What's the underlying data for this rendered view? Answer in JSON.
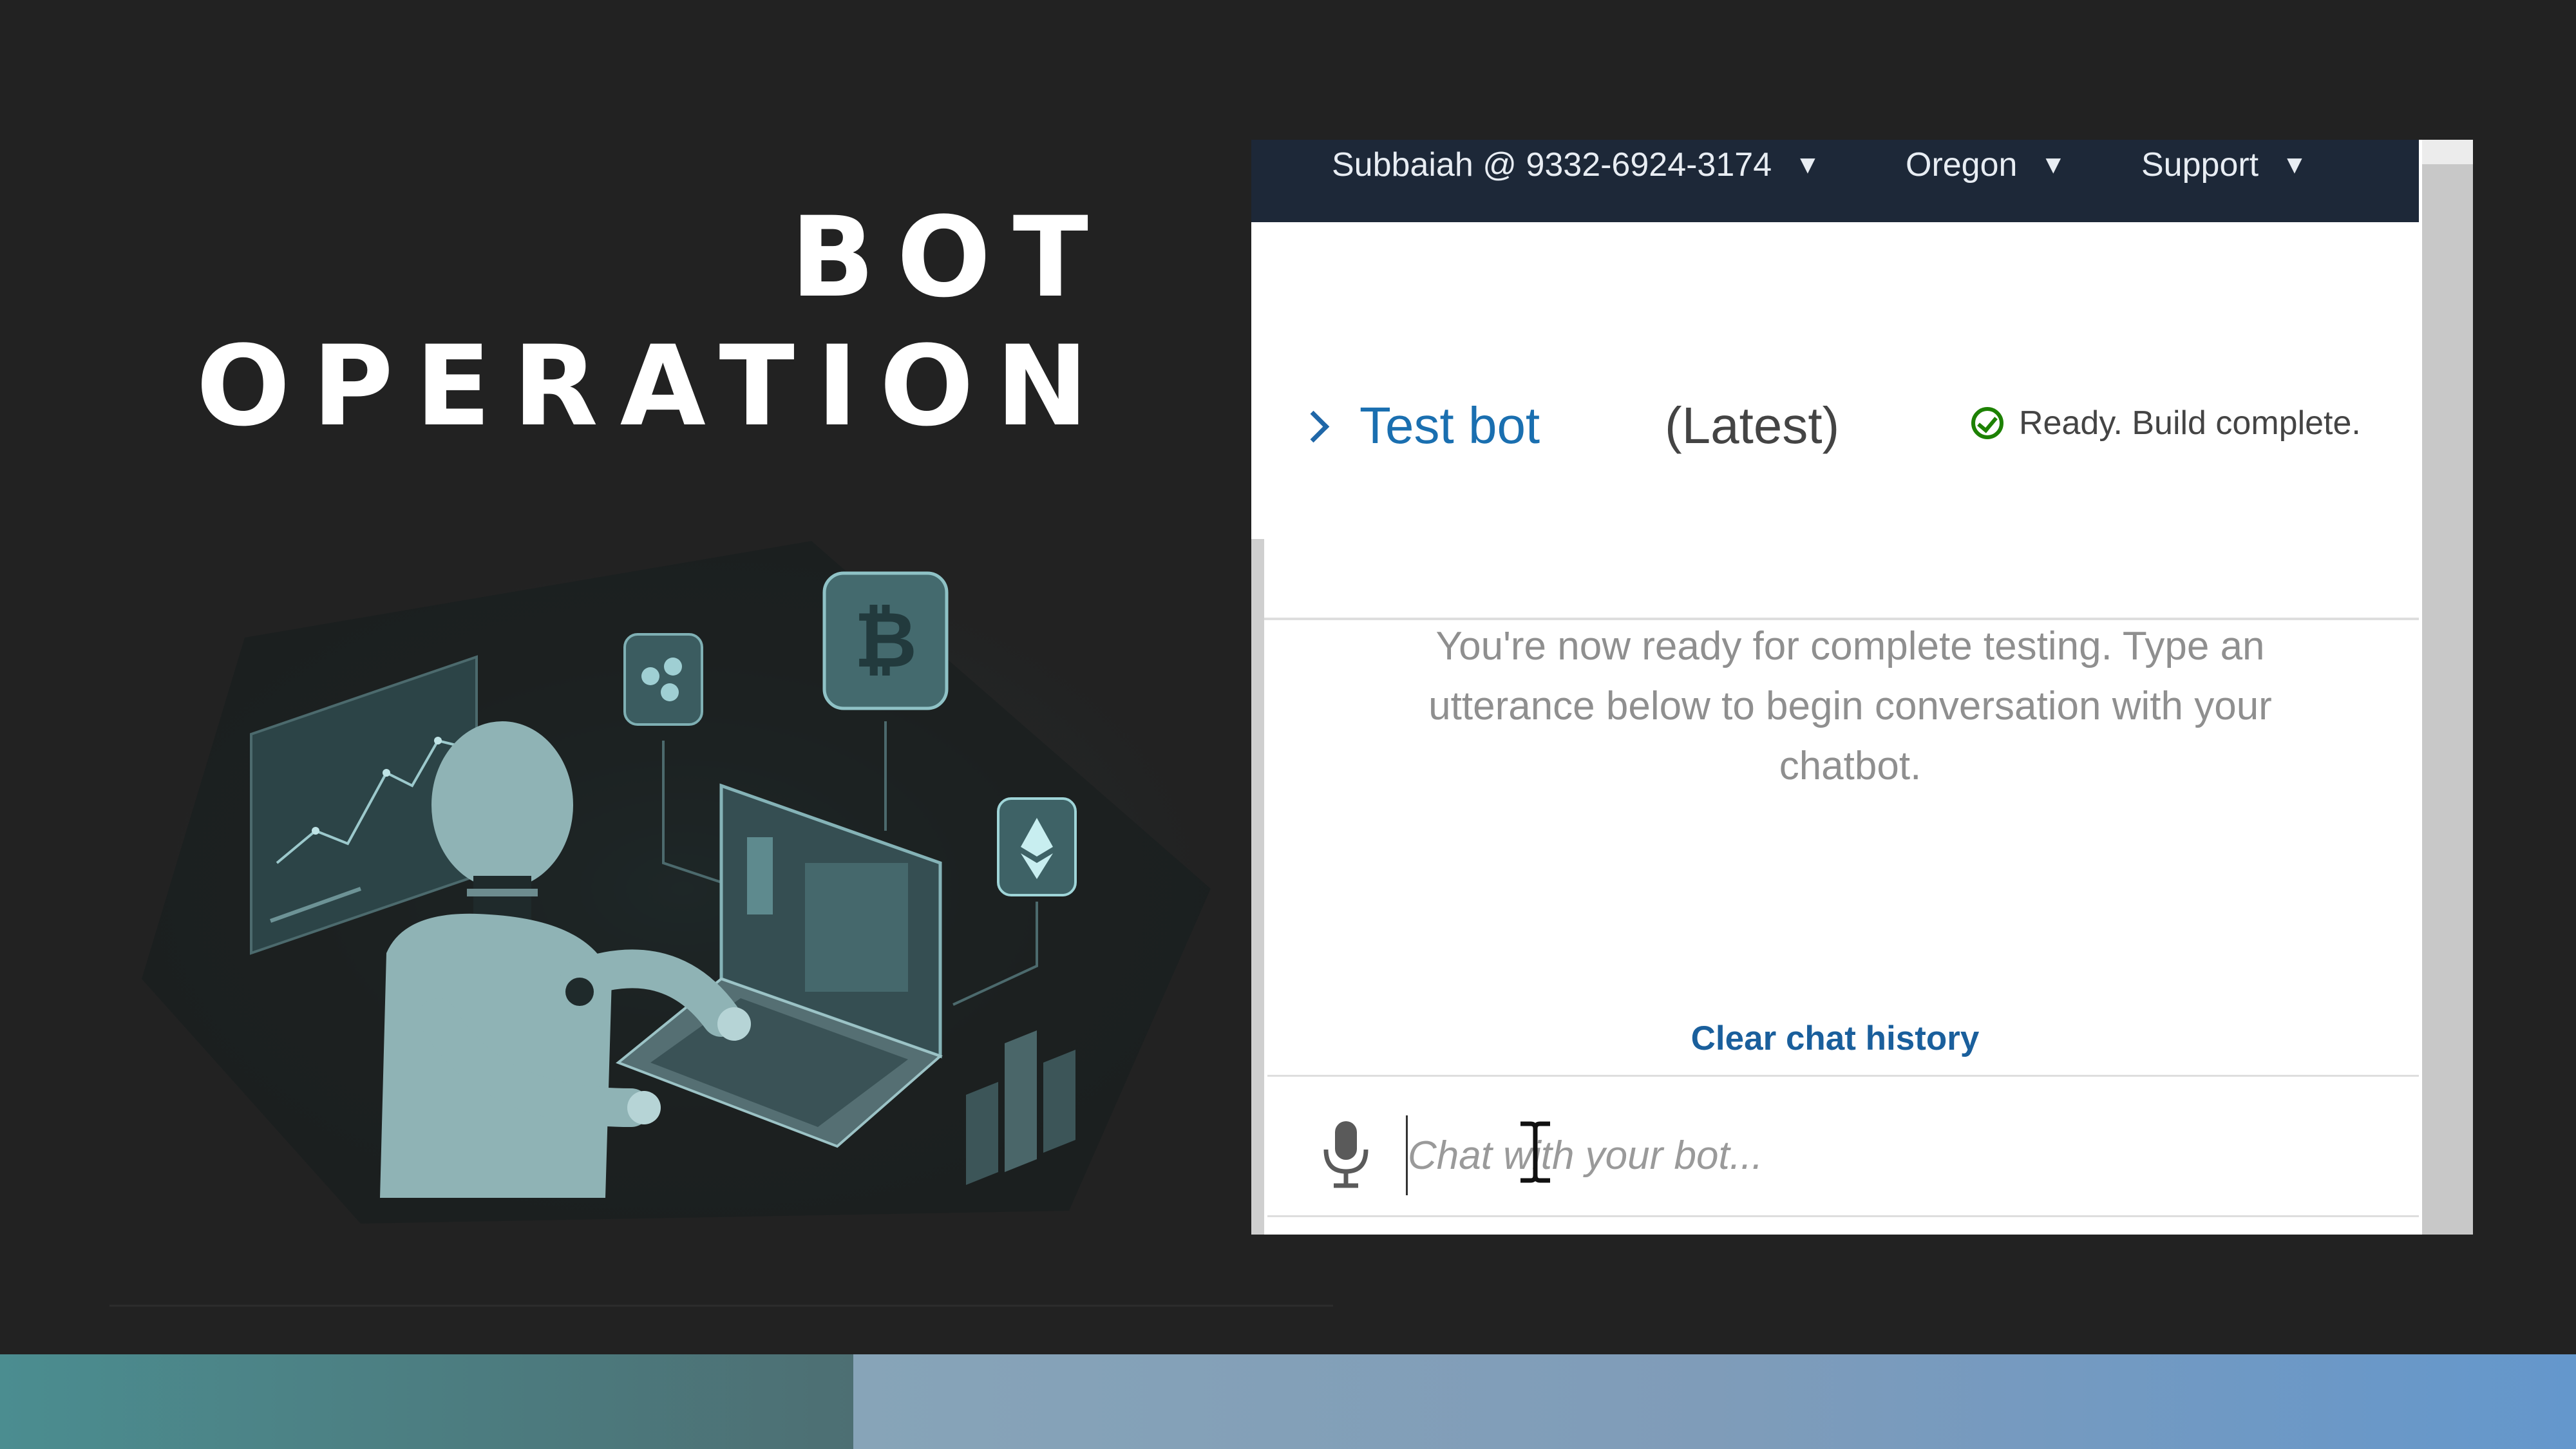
{
  "slide": {
    "title_line1": "BOT",
    "title_line2": "OPERATION"
  },
  "colors": {
    "background": "#222222",
    "console_nav": "#1d2838",
    "link_blue": "#1a6fb0",
    "success_green": "#1d8102",
    "band_left": "#4b8d90",
    "band_right": "#6497cc"
  },
  "illustration": {
    "icon": "robot-using-laptop-icon"
  },
  "console": {
    "nav": {
      "account_label": "Subbaiah @ 9332-6924-3174",
      "region_label": "Oregon",
      "support_label": "Support",
      "caret_icon": "caret-down-icon"
    },
    "test_panel": {
      "expand_icon": "chevron-right-icon",
      "bot_name": "Test bot",
      "version": "(Latest)",
      "status_icon": "check-circle-icon",
      "status_text": "Ready. Build complete.",
      "hint": "You're now ready for complete testing. Type an utterance below to begin conversation with your chatbot.",
      "clear_history_label": "Clear chat history",
      "mic_icon": "microphone-icon",
      "input_value": "",
      "input_placeholder": "Chat with your bot..."
    }
  }
}
